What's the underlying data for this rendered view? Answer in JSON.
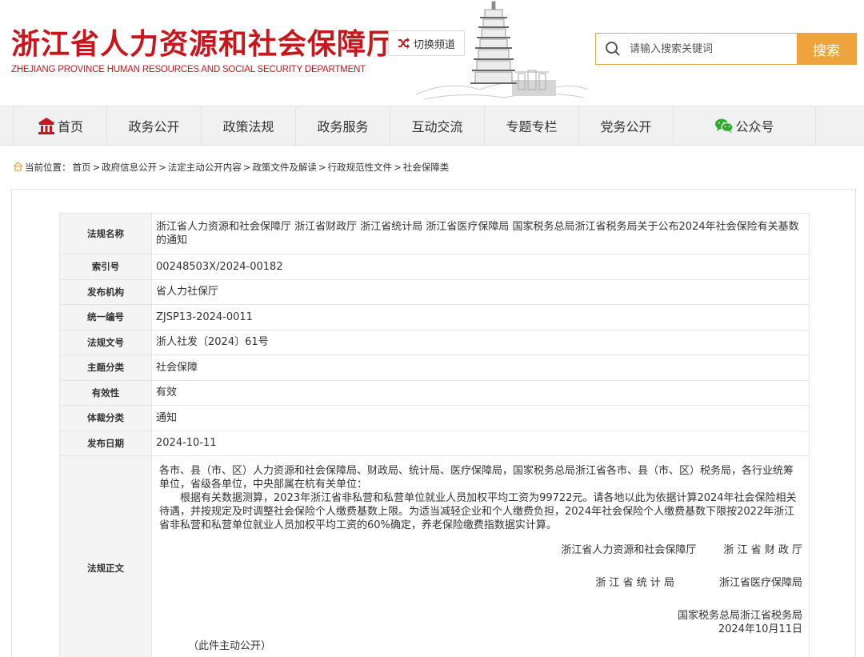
{
  "header": {
    "title": "浙江省人力资源和社会保障厅",
    "subtitle": "ZHEJIANG PROVINCE HUMAN RESOURCES AND SOCIAL SECURITY DEPARTMENT",
    "switch_label": "切换频道",
    "search_placeholder": "请输入搜索关键词",
    "search_button": "搜索"
  },
  "nav": {
    "items": [
      "首页",
      "政务公开",
      "政策法规",
      "政务服务",
      "互动交流",
      "专题专栏",
      "党务公开",
      "公众号"
    ]
  },
  "breadcrumb": {
    "prefix": "当前位置：",
    "items": [
      "首页",
      "政府信息公开",
      "法定主动公开内容",
      "政策文件及解读",
      "行政规范性文件",
      "社会保障类"
    ],
    "separator": ">"
  },
  "doc": {
    "fields": [
      {
        "label": "法规名称",
        "value": "浙江省人力资源和社会保障厅 浙江省财政厅 浙江省统计局 浙江省医疗保障局 国家税务总局浙江省税务局关于公布2024年社会保险有关基数的通知"
      },
      {
        "label": "索引号",
        "value": "00248503X/2024-00182"
      },
      {
        "label": "发布机构",
        "value": "省人力社保厅"
      },
      {
        "label": "统一编号",
        "value": "ZJSP13-2024-0011"
      },
      {
        "label": "法规文号",
        "value": "浙人社发〔2024〕61号"
      },
      {
        "label": "主题分类",
        "value": "社会保障"
      },
      {
        "label": "有效性",
        "value": "有效"
      },
      {
        "label": "体裁分类",
        "value": "通知"
      },
      {
        "label": "发布日期",
        "value": "2024-10-11"
      }
    ],
    "body_label": "法规正文",
    "body_addressee": "各市、县（市、区）人力资源和社会保障局、财政局、统计局、医疗保障局，国家税务总局浙江省各市、县（市、区）税务局，各行业统筹单位，省级各单位，中央部属在杭有关单位：",
    "body_paragraph": "根据有关数据测算，2023年浙江省非私营和私营单位就业人员加权平均工资为99722元。请各地以此为依据计算2024年社会保险相关待遇，并按规定及时调整社会保险个人缴费基数上限。为适当减轻企业和个人缴费负担，2024年社会保险个人缴费基数下限按2022年浙江省非私营和私营单位就业人员加权平均工资的60%确定，养老保险缴费指数据实计算。",
    "signatories": [
      "浙江省人力资源和社会保障厅",
      "浙 江 省 财 政 厅",
      "浙 江 省 统 计 局",
      "浙江省医疗保障局",
      "国家税务总局浙江省税务局"
    ],
    "sign_date": "2024年10月11日",
    "footnote": "（此件主动公开）"
  },
  "colors": {
    "brand_red": "#c8161d",
    "accent_orange": "#eea33d"
  },
  "icons": [
    "shuffle-icon",
    "search-icon",
    "home-icon",
    "wechat-icon",
    "home-small-icon"
  ]
}
